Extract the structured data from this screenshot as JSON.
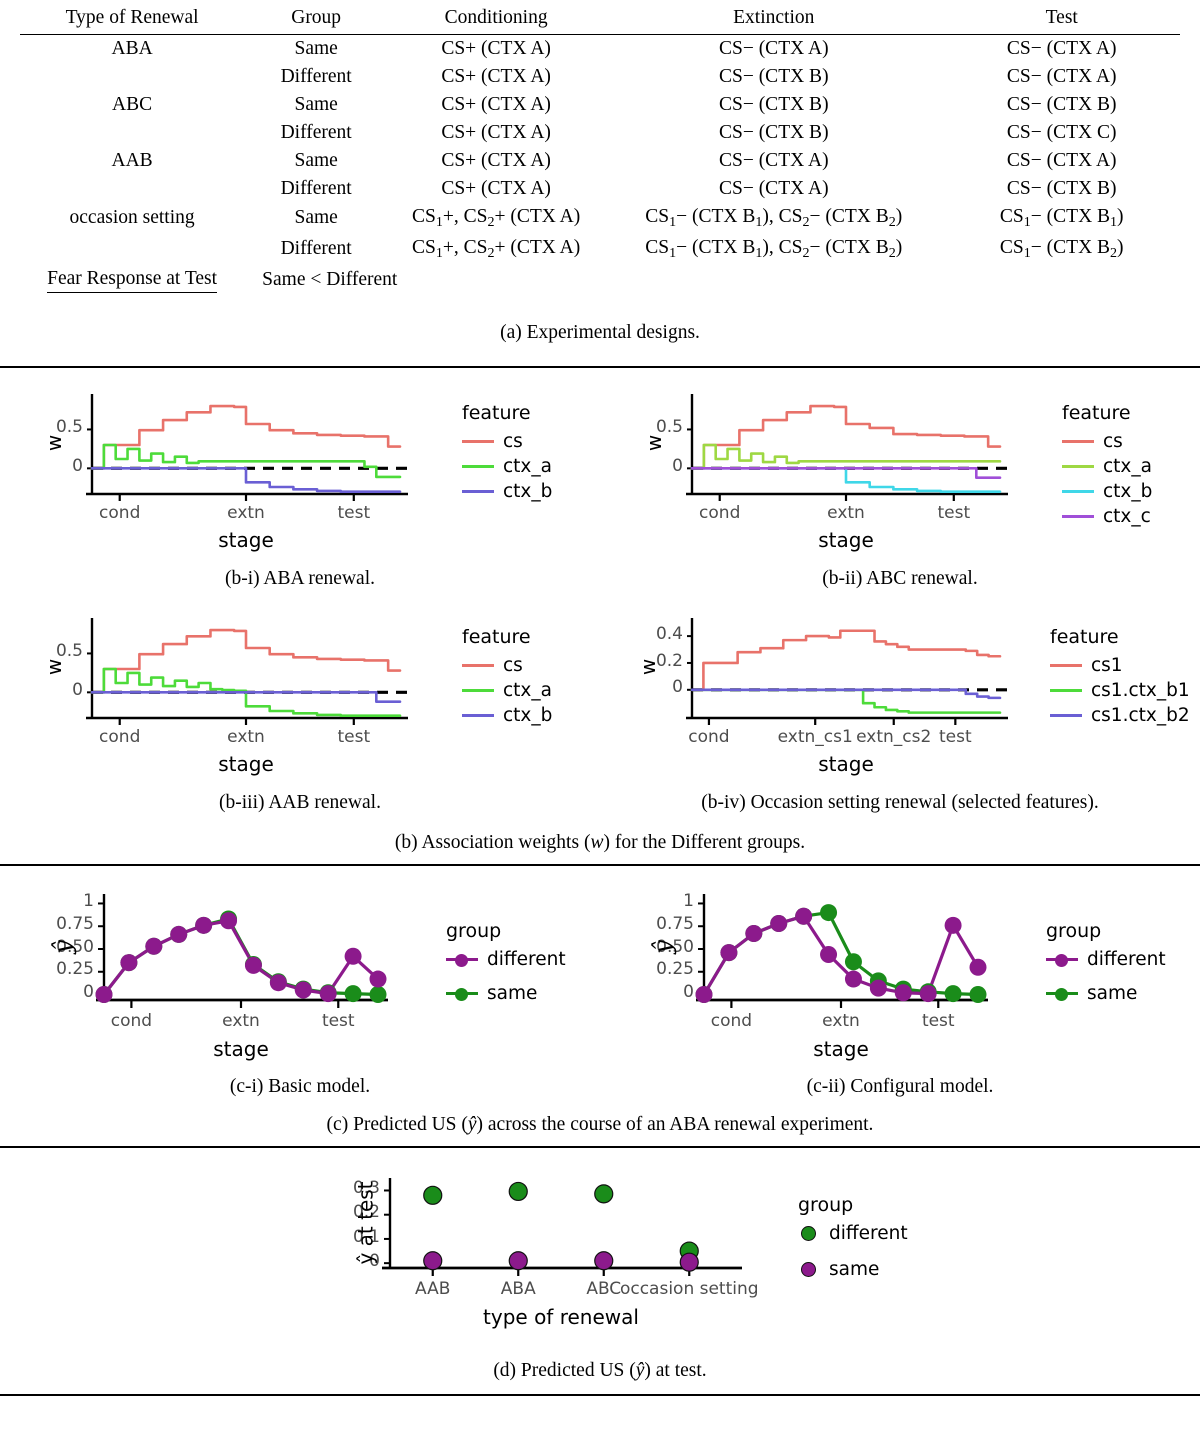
{
  "table": {
    "headers": [
      "Type of Renewal",
      "Group",
      "Conditioning",
      "Extinction",
      "Test"
    ],
    "rows": [
      {
        "type": "ABA",
        "group": "Same",
        "cond": "CS+ (CTX A)",
        "extn": "CS− (CTX A)",
        "test": "CS− (CTX A)"
      },
      {
        "type": "",
        "group": "Different",
        "cond": "CS+ (CTX A)",
        "extn": "CS− (CTX B)",
        "test": "CS− (CTX A)"
      },
      {
        "type": "ABC",
        "group": "Same",
        "cond": "CS+ (CTX A)",
        "extn": "CS− (CTX B)",
        "test": "CS− (CTX B)"
      },
      {
        "type": "",
        "group": "Different",
        "cond": "CS+ (CTX A)",
        "extn": "CS− (CTX B)",
        "test": "CS− (CTX C)"
      },
      {
        "type": "AAB",
        "group": "Same",
        "cond": "CS+ (CTX A)",
        "extn": "CS− (CTX A)",
        "test": "CS− (CTX A)"
      },
      {
        "type": "",
        "group": "Different",
        "cond": "CS+ (CTX A)",
        "extn": "CS− (CTX A)",
        "test": "CS− (CTX B)"
      },
      {
        "type": "occasion setting",
        "group": "Same",
        "cond": "CS1+, CS2+ (CTX A)",
        "extn": "CS1− (CTX B1), CS2− (CTX B2)",
        "test": "CS1− (CTX B1)"
      },
      {
        "type": "",
        "group": "Different",
        "cond": "CS1+, CS2+ (CTX A)",
        "extn": "CS1− (CTX B1), CS2− (CTX B2)",
        "test": "CS1− (CTX B2)"
      }
    ],
    "footer_label": "Fear Response at Test",
    "footer_value": "Same < Different",
    "caption": "(a) Experimental designs."
  },
  "captions": {
    "b_i": "(b-i) ABA renewal.",
    "b_ii": "(b-ii) ABC renewal.",
    "b_iii": "(b-iii) AAB renewal.",
    "b_iv": "(b-iv) Occasion setting renewal (selected features).",
    "b": "(b) Association weights (w) for the Different groups.",
    "c_i": "(c-i) Basic model.",
    "c_ii": "(c-ii) Configural model.",
    "c": "(c) Predicted US (ŷ) across the course of an ABA renewal experiment.",
    "d": "(d) Predicted US (ŷ) at test."
  },
  "colors": {
    "cs": "#e8726a",
    "ctx_a_green": "#4ddb3a",
    "ctx_a_yellowgreen": "#9ed843",
    "ctx_b_blue": "#6a5fd4",
    "ctx_b_cyan": "#3fd7e8",
    "ctx_c_purple": "#a04fd8",
    "different_purple": "#8c1a8c",
    "same_green": "#1a8c1a",
    "zero_line": "#000000"
  },
  "chart_data": [
    {
      "id": "b-i",
      "type": "line",
      "title": "(b-i) ABA renewal.",
      "xlabel": "stage",
      "ylabel": "w",
      "ylim": [
        -0.33,
        0.93
      ],
      "yticks": [
        0,
        0.5
      ],
      "yticklabels": [
        "0",
        "0.5"
      ],
      "xticks": [
        "cond",
        "extn",
        "test"
      ],
      "xtick_positions": [
        0.09,
        0.5,
        0.85
      ],
      "legend_title": "feature",
      "grid": false,
      "legend_position": "right",
      "series": [
        {
          "name": "cs",
          "color": "#e8726a",
          "values": [
            0.0,
            0.3,
            0.3,
            0.3,
            0.49,
            0.49,
            0.62,
            0.62,
            0.72,
            0.72,
            0.8,
            0.8,
            0.79,
            0.57,
            0.57,
            0.49,
            0.49,
            0.45,
            0.45,
            0.43,
            0.43,
            0.42,
            0.42,
            0.41,
            0.41,
            0.28,
            0.28
          ]
        },
        {
          "name": "ctx_a",
          "color": "#4ddb3a",
          "values": [
            0.0,
            0.3,
            0.12,
            0.25,
            0.1,
            0.19,
            0.08,
            0.15,
            0.07,
            0.09,
            0.09,
            0.09,
            0.09,
            0.09,
            0.09,
            0.09,
            0.09,
            0.09,
            0.09,
            0.09,
            0.09,
            0.09,
            0.09,
            0.02,
            -0.11,
            -0.11,
            -0.11
          ]
        },
        {
          "name": "ctx_b",
          "color": "#6a5fd4",
          "values": [
            0.0,
            0.0,
            0.0,
            0.0,
            0.0,
            0.0,
            0.0,
            0.0,
            0.0,
            0.0,
            0.0,
            0.0,
            0.0,
            -0.18,
            -0.18,
            -0.24,
            -0.24,
            -0.27,
            -0.27,
            -0.29,
            -0.29,
            -0.3,
            -0.3,
            -0.3,
            -0.3,
            -0.3,
            -0.3
          ]
        }
      ]
    },
    {
      "id": "b-ii",
      "type": "line",
      "title": "(b-ii) ABC renewal.",
      "xlabel": "stage",
      "ylabel": "w",
      "ylim": [
        -0.33,
        0.93
      ],
      "yticks": [
        0,
        0.5
      ],
      "yticklabels": [
        "0",
        "0.5"
      ],
      "xticks": [
        "cond",
        "extn",
        "test"
      ],
      "xtick_positions": [
        0.09,
        0.5,
        0.85
      ],
      "legend_title": "feature",
      "grid": false,
      "legend_position": "right",
      "series": [
        {
          "name": "cs",
          "color": "#e8726a",
          "values": [
            0.0,
            0.3,
            0.3,
            0.3,
            0.49,
            0.49,
            0.62,
            0.62,
            0.72,
            0.72,
            0.8,
            0.8,
            0.79,
            0.57,
            0.57,
            0.52,
            0.52,
            0.44,
            0.44,
            0.43,
            0.43,
            0.42,
            0.42,
            0.41,
            0.41,
            0.28,
            0.28
          ]
        },
        {
          "name": "ctx_a",
          "color": "#9ed843",
          "values": [
            0.0,
            0.3,
            0.12,
            0.25,
            0.1,
            0.19,
            0.08,
            0.15,
            0.07,
            0.09,
            0.09,
            0.09,
            0.09,
            0.09,
            0.09,
            0.09,
            0.09,
            0.09,
            0.09,
            0.09,
            0.09,
            0.09,
            0.09,
            0.09,
            0.09,
            0.09,
            0.09
          ]
        },
        {
          "name": "ctx_b",
          "color": "#3fd7e8",
          "values": [
            0.0,
            0.0,
            0.0,
            0.0,
            0.0,
            0.0,
            0.0,
            0.0,
            0.0,
            0.0,
            0.0,
            0.0,
            0.0,
            -0.18,
            -0.18,
            -0.24,
            -0.24,
            -0.27,
            -0.27,
            -0.29,
            -0.29,
            -0.3,
            -0.3,
            -0.3,
            -0.3,
            -0.3,
            -0.3
          ]
        },
        {
          "name": "ctx_c",
          "color": "#a04fd8",
          "values": [
            0.0,
            0.0,
            0.0,
            0.0,
            0.0,
            0.0,
            0.0,
            0.0,
            0.0,
            0.0,
            0.0,
            0.0,
            0.0,
            0.0,
            0.0,
            0.0,
            0.0,
            0.0,
            0.0,
            0.0,
            0.0,
            0.0,
            0.0,
            0.0,
            -0.12,
            -0.12,
            -0.12
          ]
        }
      ]
    },
    {
      "id": "b-iii",
      "type": "line",
      "title": "(b-iii) AAB renewal.",
      "xlabel": "stage",
      "ylabel": "w",
      "ylim": [
        -0.33,
        0.93
      ],
      "yticks": [
        0,
        0.5
      ],
      "yticklabels": [
        "0",
        "0.5"
      ],
      "xticks": [
        "cond",
        "extn",
        "test"
      ],
      "xtick_positions": [
        0.09,
        0.5,
        0.85
      ],
      "legend_title": "feature",
      "grid": false,
      "legend_position": "right",
      "series": [
        {
          "name": "cs",
          "color": "#e8726a",
          "values": [
            0.0,
            0.3,
            0.3,
            0.3,
            0.49,
            0.49,
            0.62,
            0.62,
            0.72,
            0.72,
            0.8,
            0.8,
            0.79,
            0.57,
            0.57,
            0.49,
            0.49,
            0.45,
            0.45,
            0.43,
            0.43,
            0.42,
            0.42,
            0.41,
            0.41,
            0.28,
            0.28
          ]
        },
        {
          "name": "ctx_a",
          "color": "#4ddb3a",
          "values": [
            0.0,
            0.3,
            0.12,
            0.25,
            0.1,
            0.19,
            0.08,
            0.15,
            0.07,
            0.12,
            0.04,
            0.03,
            0.02,
            -0.18,
            -0.18,
            -0.24,
            -0.24,
            -0.27,
            -0.27,
            -0.29,
            -0.29,
            -0.3,
            -0.3,
            -0.3,
            -0.3,
            -0.3,
            -0.3
          ]
        },
        {
          "name": "ctx_b",
          "color": "#6a5fd4",
          "values": [
            0.0,
            0.0,
            0.0,
            0.0,
            0.0,
            0.0,
            0.0,
            0.0,
            0.0,
            0.0,
            0.0,
            0.0,
            0.0,
            0.0,
            0.0,
            0.0,
            0.0,
            0.0,
            0.0,
            0.0,
            0.0,
            0.0,
            0.0,
            0.0,
            -0.12,
            -0.12,
            -0.12
          ]
        }
      ]
    },
    {
      "id": "b-iv",
      "type": "line",
      "title": "(b-iv) Occasion setting renewal (selected features).",
      "xlabel": "stage",
      "ylabel": "w",
      "ylim": [
        -0.21,
        0.52
      ],
      "yticks": [
        0,
        0.2,
        0.4
      ],
      "yticklabels": [
        "0",
        "0.2",
        "0.4"
      ],
      "xticks": [
        "cond",
        "extn_cs1",
        "extn_cs2",
        "test"
      ],
      "xtick_positions": [
        0.055,
        0.4,
        0.655,
        0.855
      ],
      "legend_title": "feature",
      "grid": false,
      "legend_position": "right",
      "series": [
        {
          "name": "cs1",
          "color": "#e8726a",
          "values": [
            0.0,
            0.2,
            0.2,
            0.2,
            0.28,
            0.28,
            0.31,
            0.31,
            0.37,
            0.37,
            0.4,
            0.4,
            0.39,
            0.44,
            0.44,
            0.44,
            0.36,
            0.34,
            0.32,
            0.3,
            0.3,
            0.3,
            0.3,
            0.3,
            0.29,
            0.26,
            0.25,
            0.25
          ]
        },
        {
          "name": "cs1.ctx_b1",
          "color": "#4ddb3a",
          "values": [
            0.0,
            0.0,
            0.0,
            0.0,
            0.0,
            0.0,
            0.0,
            0.0,
            0.0,
            0.0,
            0.0,
            0.0,
            0.0,
            0.0,
            0.0,
            -0.1,
            -0.13,
            -0.15,
            -0.16,
            -0.17,
            -0.17,
            -0.17,
            -0.17,
            -0.17,
            -0.17,
            -0.17,
            -0.17,
            -0.17
          ]
        },
        {
          "name": "cs1.ctx_b2",
          "color": "#6a5fd4",
          "values": [
            0.0,
            0.0,
            0.0,
            0.0,
            0.0,
            0.0,
            0.0,
            0.0,
            0.0,
            0.0,
            0.0,
            0.0,
            0.0,
            0.0,
            0.0,
            0.0,
            0.0,
            0.0,
            0.0,
            0.0,
            0.0,
            0.0,
            0.0,
            0.0,
            -0.03,
            -0.05,
            -0.06,
            -0.06
          ]
        }
      ]
    },
    {
      "id": "c-i",
      "type": "line",
      "title": "(c-i) Basic model.",
      "xlabel": "stage",
      "ylabel": "ŷ",
      "ylim": [
        -0.06,
        1.06
      ],
      "yticks": [
        0,
        0.25,
        0.5,
        0.75,
        1
      ],
      "yticklabels": [
        "0",
        "0.25",
        "0.50",
        "0.75",
        "1"
      ],
      "xticks": [
        "cond",
        "extn",
        "test"
      ],
      "xtick_positions": [
        0.1,
        0.5,
        0.855
      ],
      "legend_title": "group",
      "grid": false,
      "legend_position": "right",
      "series": [
        {
          "name": "different",
          "color": "#8c1a8c",
          "values": [
            0.0,
            0.35,
            0.53,
            0.66,
            0.76,
            0.81,
            0.32,
            0.13,
            0.05,
            0.01,
            0.42,
            0.17
          ]
        },
        {
          "name": "same",
          "color": "#1a8c1a",
          "values": [
            0.0,
            0.35,
            0.53,
            0.66,
            0.76,
            0.83,
            0.33,
            0.14,
            0.06,
            0.02,
            0.01,
            0.0
          ]
        }
      ],
      "x_indices": [
        0,
        1,
        2,
        3,
        4,
        5,
        6,
        7,
        8,
        9,
        10,
        11
      ]
    },
    {
      "id": "c-ii",
      "type": "line",
      "title": "(c-ii) Configural model.",
      "xlabel": "stage",
      "ylabel": "ŷ",
      "ylim": [
        -0.06,
        1.06
      ],
      "yticks": [
        0,
        0.25,
        0.5,
        0.75,
        1
      ],
      "yticklabels": [
        "0",
        "0.25",
        "0.50",
        "0.75",
        "1"
      ],
      "xticks": [
        "cond",
        "extn",
        "test"
      ],
      "xtick_positions": [
        0.1,
        0.5,
        0.855
      ],
      "legend_title": "group",
      "grid": false,
      "legend_position": "right",
      "series": [
        {
          "name": "different",
          "color": "#8c1a8c",
          "values": [
            0.0,
            0.46,
            0.67,
            0.78,
            0.86,
            0.44,
            0.17,
            0.07,
            0.02,
            0.01,
            0.76,
            0.3
          ]
        },
        {
          "name": "same",
          "color": "#1a8c1a",
          "values": [
            0.0,
            0.46,
            0.67,
            0.78,
            0.86,
            0.9,
            0.36,
            0.15,
            0.06,
            0.03,
            0.01,
            0.0
          ]
        }
      ],
      "x_indices": [
        0,
        1,
        2,
        3,
        4,
        5,
        6,
        7,
        8,
        9,
        10,
        11
      ]
    },
    {
      "id": "d",
      "type": "scatter",
      "title": "(d) Predicted US (ŷ) at test.",
      "xlabel": "type of renewal",
      "ylabel": "ŷ at test",
      "ylim": [
        -0.02,
        0.335
      ],
      "yticks": [
        0,
        0.1,
        0.2,
        0.3
      ],
      "yticklabels": [
        "0",
        "0.1",
        "0.2",
        "0.3"
      ],
      "categories": [
        "AAB",
        "ABA",
        "ABC",
        "occasion setting"
      ],
      "legend_title": "group",
      "grid": false,
      "legend_position": "right",
      "series": [
        {
          "name": "different",
          "color": "#1a8c1a",
          "values": [
            0.28,
            0.296,
            0.286,
            0.05
          ]
        },
        {
          "name": "same",
          "color": "#8c1a8c",
          "values": [
            0.01,
            0.01,
            0.01,
            0.004
          ]
        }
      ]
    }
  ]
}
